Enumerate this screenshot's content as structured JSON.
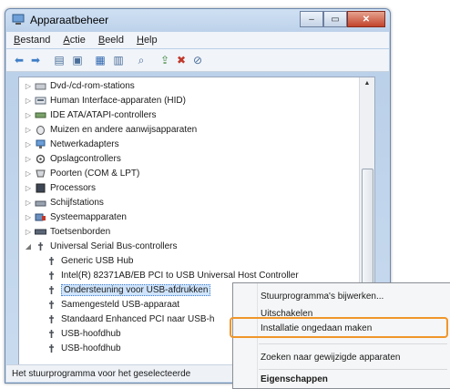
{
  "window": {
    "title": "Apparaatbeheer",
    "controls": [
      "minimize-icon",
      "maximize-icon",
      "close-icon"
    ]
  },
  "menubar": [
    "Bestand",
    "Actie",
    "Beeld",
    "Help"
  ],
  "toolbar": [
    "back-arrow-icon",
    "forward-arrow-icon",
    "properties-icon",
    "details-icon",
    "help-icon",
    "view-icon",
    "scan-hardware-icon",
    "update-driver-icon",
    "uninstall-icon",
    "disable-icon"
  ],
  "tree": [
    {
      "label": "Dvd-/cd-rom-stations",
      "icon": "dvd-drive-icon",
      "expanded": false
    },
    {
      "label": "Human Interface-apparaten (HID)",
      "icon": "hid-icon",
      "expanded": false
    },
    {
      "label": "IDE ATA/ATAPI-controllers",
      "icon": "ide-controller-icon",
      "expanded": false
    },
    {
      "label": "Muizen en andere aanwijsapparaten",
      "icon": "mouse-icon",
      "expanded": false
    },
    {
      "label": "Netwerkadapters",
      "icon": "network-adapter-icon",
      "expanded": false
    },
    {
      "label": "Opslagcontrollers",
      "icon": "storage-controller-icon",
      "expanded": false
    },
    {
      "label": "Poorten (COM & LPT)",
      "icon": "port-icon",
      "expanded": false
    },
    {
      "label": "Processors",
      "icon": "processor-icon",
      "expanded": false
    },
    {
      "label": "Schijfstations",
      "icon": "disk-drive-icon",
      "expanded": false
    },
    {
      "label": "Systeemapparaten",
      "icon": "system-device-icon",
      "expanded": false
    },
    {
      "label": "Toetsenborden",
      "icon": "keyboard-icon",
      "expanded": false
    },
    {
      "label": "Universal Serial Bus-controllers",
      "icon": "usb-icon",
      "expanded": true
    },
    {
      "label": "Generic USB Hub",
      "icon": "usb-icon",
      "child": true
    },
    {
      "label": "Intel(R) 82371AB/EB PCI to USB Universal Host Controller",
      "icon": "usb-icon",
      "child": true
    },
    {
      "label": "Ondersteuning voor USB-afdrukken",
      "icon": "usb-icon",
      "child": true,
      "selected": true
    },
    {
      "label": "Samengesteld USB-apparaat",
      "icon": "usb-icon",
      "child": true
    },
    {
      "label": "Standaard Enhanced PCI naar USB-h",
      "icon": "usb-icon",
      "child": true
    },
    {
      "label": "USB-hoofdhub",
      "icon": "usb-icon",
      "child": true
    },
    {
      "label": "USB-hoofdhub",
      "icon": "usb-icon",
      "child": true
    }
  ],
  "status": "Het stuurprogramma voor het geselecteerde",
  "context_menu": {
    "items": [
      "Stuurprogramma's bijwerken...",
      "Uitschakelen",
      "Installatie ongedaan maken",
      "Zoeken naar gewijzigde apparaten",
      "Eigenschappen"
    ],
    "highlighted_index": 2,
    "highlight_color": "#f0962a"
  }
}
